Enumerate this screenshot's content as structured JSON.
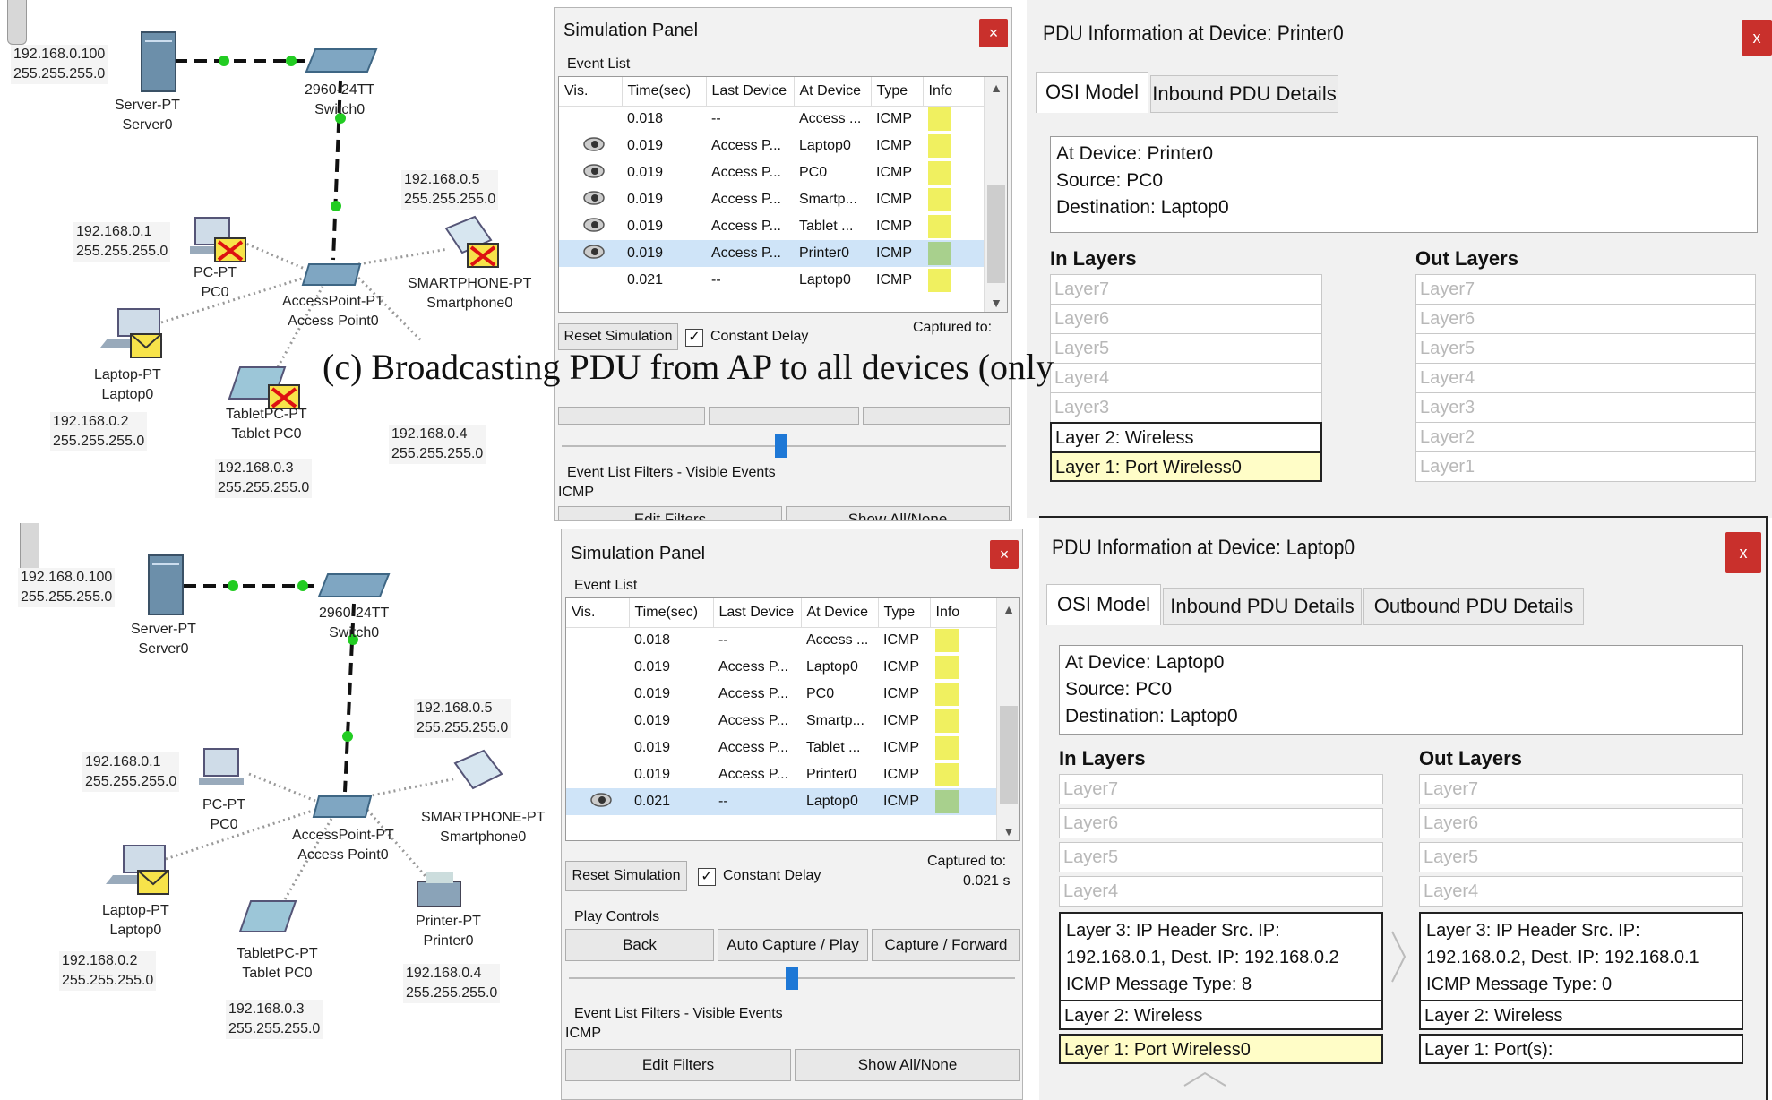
{
  "caption": "(c) Broadcasting PDU from AP to all devices (only",
  "topology_top": {
    "server": {
      "type": "Server-PT",
      "name": "Server0",
      "ip": "192.168.0.100",
      "mask": "255.255.255.0"
    },
    "switch": {
      "type": "2960-24TT",
      "name": "Switch0"
    },
    "pc": {
      "type": "PC-PT",
      "name": "PC0",
      "ip": "192.168.0.1",
      "mask": "255.255.255.0"
    },
    "ap": {
      "type": "AccessPoint-PT",
      "name": "Access Point0"
    },
    "phone": {
      "type": "SMARTPHONE-PT",
      "name": "Smartphone0",
      "ip": "192.168.0.5",
      "mask": "255.255.255.0"
    },
    "laptop": {
      "type": "Laptop-PT",
      "name": "Laptop0",
      "ip": "192.168.0.2",
      "mask": "255.255.255.0"
    },
    "tablet": {
      "type": "TabletPC-PT",
      "name": "Tablet PC0",
      "ip": "192.168.0.3",
      "mask": "255.255.255.0"
    },
    "printer": {
      "ip": "192.168.0.4",
      "mask": "255.255.255.0"
    }
  },
  "topology_bottom": {
    "server": {
      "type": "Server-PT",
      "name": "Server0",
      "ip": "192.168.0.100",
      "mask": "255.255.255.0"
    },
    "switch": {
      "type": "2960-24TT",
      "name": "Switch0"
    },
    "pc": {
      "type": "PC-PT",
      "name": "PC0",
      "ip": "192.168.0.1",
      "mask": "255.255.255.0"
    },
    "ap": {
      "type": "AccessPoint-PT",
      "name": "Access Point0"
    },
    "phone": {
      "type": "SMARTPHONE-PT",
      "name": "Smartphone0",
      "ip": "192.168.0.5",
      "mask": "255.255.255.0"
    },
    "laptop": {
      "type": "Laptop-PT",
      "name": "Laptop0",
      "ip": "192.168.0.2",
      "mask": "255.255.255.0"
    },
    "tablet": {
      "type": "TabletPC-PT",
      "name": "Tablet PC0",
      "ip": "192.168.0.3",
      "mask": "255.255.255.0"
    },
    "printer": {
      "type": "Printer-PT",
      "name": "Printer0",
      "ip": "192.168.0.4",
      "mask": "255.255.255.0"
    }
  },
  "sim_top": {
    "title": "Simulation Panel",
    "close": "×",
    "event_list_label": "Event List",
    "columns": [
      "Vis.",
      "Time(sec)",
      "Last Device",
      "At Device",
      "Type",
      "Info"
    ],
    "rows": [
      {
        "vis": false,
        "time": "0.018",
        "last": "--",
        "at": "Access ...",
        "type": "ICMP",
        "info": "#f0f060",
        "selected": false
      },
      {
        "vis": true,
        "time": "0.019",
        "last": "Access P...",
        "at": "Laptop0",
        "type": "ICMP",
        "info": "#f0f060",
        "selected": false
      },
      {
        "vis": true,
        "time": "0.019",
        "last": "Access P...",
        "at": "PC0",
        "type": "ICMP",
        "info": "#f0f060",
        "selected": false
      },
      {
        "vis": true,
        "time": "0.019",
        "last": "Access P...",
        "at": "Smartp...",
        "type": "ICMP",
        "info": "#f0f060",
        "selected": false
      },
      {
        "vis": true,
        "time": "0.019",
        "last": "Access P...",
        "at": "Tablet ...",
        "type": "ICMP",
        "info": "#f0f060",
        "selected": false
      },
      {
        "vis": true,
        "time": "0.019",
        "last": "Access P...",
        "at": "Printer0",
        "type": "ICMP",
        "info": "#a8d08d",
        "selected": true
      },
      {
        "vis": false,
        "time": "0.021",
        "last": "--",
        "at": "Laptop0",
        "type": "ICMP",
        "info": "#f0f060",
        "selected": false
      }
    ],
    "reset_label": "Reset Simulation",
    "constant_delay_label": "Constant Delay",
    "constant_delay_checked": "✓",
    "captured_label": "Captured to:",
    "filters_label": "Event List Filters - Visible Events",
    "filters_value": "ICMP",
    "edit_filters": "Edit Filters",
    "show_all": "Show All/None"
  },
  "sim_bottom": {
    "title": "Simulation Panel",
    "close": "×",
    "event_list_label": "Event List",
    "columns": [
      "Vis.",
      "Time(sec)",
      "Last Device",
      "At Device",
      "Type",
      "Info"
    ],
    "rows": [
      {
        "vis": false,
        "time": "0.018",
        "last": "--",
        "at": "Access ...",
        "type": "ICMP",
        "info": "#f0f060",
        "selected": false
      },
      {
        "vis": false,
        "time": "0.019",
        "last": "Access P...",
        "at": "Laptop0",
        "type": "ICMP",
        "info": "#f0f060",
        "selected": false
      },
      {
        "vis": false,
        "time": "0.019",
        "last": "Access P...",
        "at": "PC0",
        "type": "ICMP",
        "info": "#f0f060",
        "selected": false
      },
      {
        "vis": false,
        "time": "0.019",
        "last": "Access P...",
        "at": "Smartp...",
        "type": "ICMP",
        "info": "#f0f060",
        "selected": false
      },
      {
        "vis": false,
        "time": "0.019",
        "last": "Access P...",
        "at": "Tablet ...",
        "type": "ICMP",
        "info": "#f0f060",
        "selected": false
      },
      {
        "vis": false,
        "time": "0.019",
        "last": "Access P...",
        "at": "Printer0",
        "type": "ICMP",
        "info": "#f0f060",
        "selected": false
      },
      {
        "vis": true,
        "time": "0.021",
        "last": "--",
        "at": "Laptop0",
        "type": "ICMP",
        "info": "#a8d08d",
        "selected": true
      }
    ],
    "reset_label": "Reset Simulation",
    "constant_delay_label": "Constant Delay",
    "constant_delay_checked": "✓",
    "captured_label": "Captured to:",
    "captured_value": "0.021 s",
    "play_controls_label": "Play Controls",
    "back": "Back",
    "auto_capture": "Auto Capture / Play",
    "capture_forward": "Capture / Forward",
    "filters_label": "Event List Filters - Visible Events",
    "filters_value": "ICMP",
    "edit_filters": "Edit Filters",
    "show_all": "Show All/None"
  },
  "pdu_top": {
    "title": "PDU Information at Device: Printer0",
    "close": "x",
    "tabs": [
      "OSI Model",
      "Inbound PDU Details"
    ],
    "at_device": "At Device: Printer0",
    "source": "Source: PC0",
    "destination": "Destination: Laptop0",
    "in_heading": "In Layers",
    "out_heading": "Out Layers",
    "in_layers": [
      "Layer7",
      "Layer6",
      "Layer5",
      "Layer4",
      "Layer3",
      "Layer 2: Wireless",
      "Layer 1: Port Wireless0"
    ],
    "out_layers": [
      "Layer7",
      "Layer6",
      "Layer5",
      "Layer4",
      "Layer3",
      "Layer2",
      "Layer1"
    ]
  },
  "pdu_bottom": {
    "title": "PDU Information at Device: Laptop0",
    "close": "x",
    "tabs": [
      "OSI Model",
      "Inbound PDU Details",
      "Outbound PDU Details"
    ],
    "at_device": "At Device: Laptop0",
    "source": "Source: PC0",
    "destination": "Destination: Laptop0",
    "in_heading": "In Layers",
    "out_heading": "Out Layers",
    "in_layers": [
      "Layer7",
      "Layer6",
      "Layer5",
      "Layer4"
    ],
    "in_l3": [
      "Layer 3: IP Header Src. IP:",
      "192.168.0.1, Dest. IP: 192.168.0.2",
      "ICMP Message Type: 8"
    ],
    "in_l2": "Layer 2: Wireless",
    "in_l1": "Layer 1: Port Wireless0",
    "out_layers": [
      "Layer7",
      "Layer6",
      "Layer5",
      "Layer4"
    ],
    "out_l3": [
      "Layer 3: IP Header Src. IP:",
      "192.168.0.2, Dest. IP: 192.168.0.1",
      "ICMP Message Type: 0"
    ],
    "out_l2": "Layer 2: Wireless",
    "out_l1": "Layer 1: Port(s):"
  },
  "colors": {
    "close_red": "#c9302c",
    "selected_row": "#cfe4f8",
    "highlight_layer": "#fffdc7",
    "link_green": "#22cc33"
  }
}
